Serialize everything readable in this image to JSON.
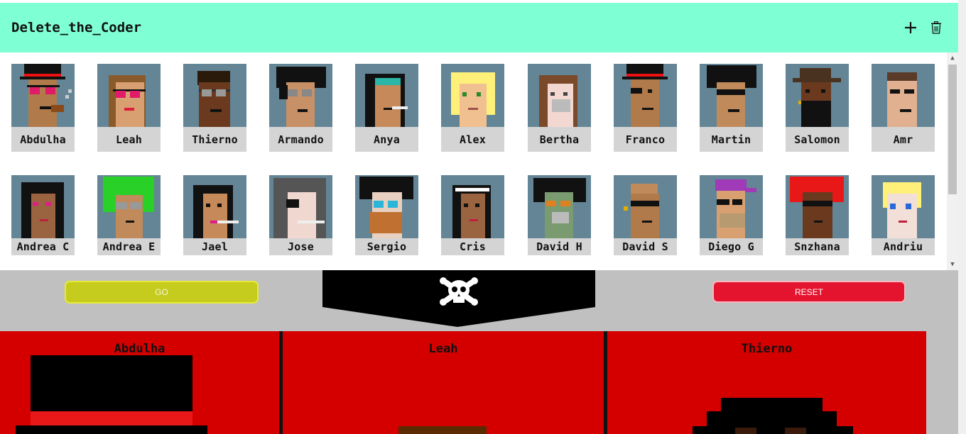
{
  "app": {
    "title": "Delete_the_Coder"
  },
  "header_actions": {
    "add_icon": "plus-icon",
    "delete_icon": "trash-icon"
  },
  "coders_row1": [
    {
      "name": "Abdulha"
    },
    {
      "name": "Leah"
    },
    {
      "name": "Thierno"
    },
    {
      "name": "Armando"
    },
    {
      "name": "Anya"
    },
    {
      "name": "Alex"
    },
    {
      "name": "Bertha"
    },
    {
      "name": "Franco"
    },
    {
      "name": "Martin"
    },
    {
      "name": "Salomon"
    },
    {
      "name": "Amr"
    }
  ],
  "coders_row2": [
    {
      "name": "Andrea C"
    },
    {
      "name": "Andrea E"
    },
    {
      "name": "Jael"
    },
    {
      "name": "Jose"
    },
    {
      "name": "Sergio"
    },
    {
      "name": "Cris"
    },
    {
      "name": "David H"
    },
    {
      "name": "David S"
    },
    {
      "name": "Diego G"
    },
    {
      "name": "Snzhana"
    },
    {
      "name": "Andriu"
    }
  ],
  "controls": {
    "go_label": "GO",
    "reset_label": "RESET",
    "banner_icon": "skull-crossbones-icon"
  },
  "selected": [
    {
      "name": "Abdulha"
    },
    {
      "name": "Leah"
    },
    {
      "name": "Thierno"
    }
  ],
  "colors": {
    "header_bg": "#7fffd4",
    "portrait_bg": "#638596",
    "go": "#c5cc1d",
    "reset": "#e5142e",
    "panel": "#d40000"
  }
}
